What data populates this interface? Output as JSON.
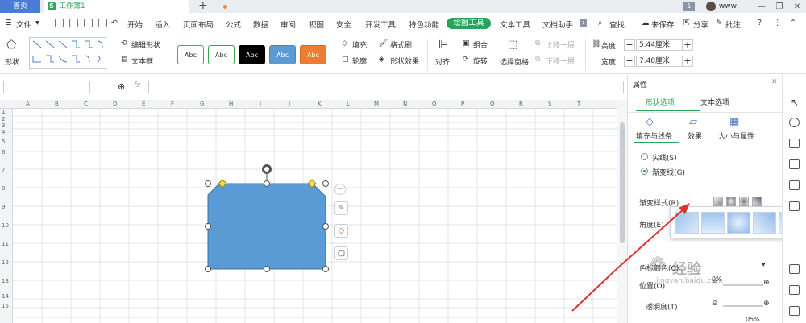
{
  "titlebar": {
    "home_tab": "首页",
    "doc_tab": "工作簿1",
    "doc_icon": "S",
    "new_tab": "+",
    "badge": "1",
    "user": "www.",
    "minimize": "—",
    "restore": "❐",
    "close": "✕"
  },
  "menu": {
    "file": "文件",
    "items": [
      "开始",
      "插入",
      "页面布局",
      "公式",
      "数据",
      "审阅",
      "视图",
      "安全",
      "开发工具",
      "特色功能"
    ],
    "active": "绘图工具",
    "after": [
      "文本工具",
      "文档助手"
    ],
    "search": "查找",
    "unsaved": "未保存",
    "share": "分享",
    "comment": "批注"
  },
  "ribbon": {
    "shape_label": "形状",
    "edit_shape": "编辑形状",
    "text_box": "文本框",
    "styles": [
      {
        "label": "Abc",
        "bg": "#ffffff",
        "fg": "#333333",
        "border": "#4a90e2"
      },
      {
        "label": "Abc",
        "bg": "#ffffff",
        "fg": "#333333",
        "border": "#3ca34f"
      },
      {
        "label": "Abc",
        "bg": "#000000",
        "fg": "#ffffff",
        "border": "#000000"
      },
      {
        "label": "Abc",
        "bg": "#5b9bd5",
        "fg": "#ffffff",
        "border": "#4a86c0"
      },
      {
        "label": "Abc",
        "bg": "#ed7d31",
        "fg": "#ffffff",
        "border": "#d06a22"
      }
    ],
    "fill": "填充",
    "format_brush": "格式刷",
    "outline": "轮廓",
    "shape_effects": "形状效果",
    "align": "对齐",
    "group": "组合",
    "rotate": "旋转",
    "selection_pane": "选择窗格",
    "bring_forward": "上移一层",
    "send_backward": "下移一层",
    "height_label": "高度:",
    "height_value": "5.44厘米",
    "width_label": "宽度:",
    "width_value": "7.48厘米"
  },
  "formula_bar": {
    "fx": "fx"
  },
  "sheet": {
    "columns": [
      "A",
      "B",
      "C",
      "D",
      "E",
      "F",
      "G",
      "H",
      "I",
      "J",
      "K",
      "L",
      "M",
      "N",
      "O",
      "P",
      "Q",
      "R",
      "S",
      "T"
    ],
    "rows": [
      "1",
      "2",
      "3",
      "4",
      "5",
      "6",
      "7",
      "8",
      "9",
      "10",
      "11",
      "12",
      "13",
      "14",
      "15"
    ],
    "shape_color": "#5b9bd5"
  },
  "panel": {
    "title": "属性",
    "tab_shape": "形状选项",
    "tab_text": "文本选项",
    "sub_fill_line": "填充与线条",
    "sub_effects": "效果",
    "sub_size": "大小与属性",
    "radio_solid": "实线(S)",
    "radio_gradient": "渐变线(G)",
    "gradient_style": "渐变样式(R)",
    "angle": "角度(E)",
    "color_stop": "色标颜色(C)",
    "position": "位置(O)",
    "transparency": "透明度(T)",
    "percent1": "0%",
    "percent2": "05%",
    "accent": "#26a55a"
  },
  "watermark": {
    "brand": "经验",
    "url": "jingyan.baidu.com"
  }
}
